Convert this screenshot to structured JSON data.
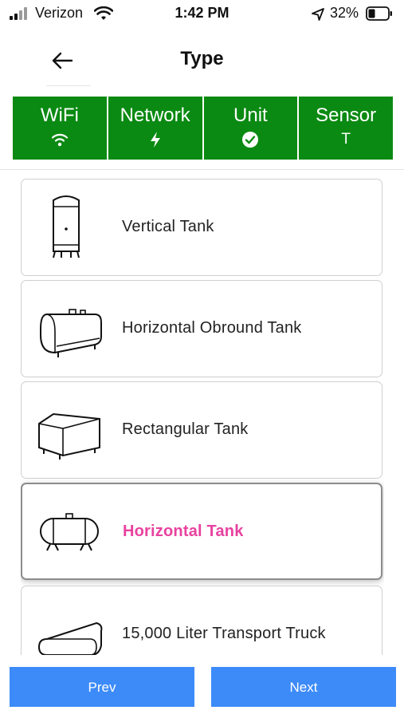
{
  "status": {
    "carrier": "Verizon",
    "time": "1:42 PM",
    "battery": "32%"
  },
  "header": {
    "title": "Type"
  },
  "steps": [
    {
      "label": "WiFi",
      "icon": "wifi-icon"
    },
    {
      "label": "Network",
      "icon": "bolt-icon"
    },
    {
      "label": "Unit",
      "icon": "check-circle-icon"
    },
    {
      "label": "Sensor",
      "icon_text": "T"
    }
  ],
  "tank_types": [
    {
      "label": "Vertical Tank",
      "icon": "vertical-tank-icon"
    },
    {
      "label": "Horizontal Obround Tank",
      "icon": "horizontal-obround-tank-icon"
    },
    {
      "label": "Rectangular Tank",
      "icon": "rectangular-tank-icon"
    },
    {
      "label": "Horizontal Tank",
      "icon": "horizontal-tank-icon",
      "selected": true
    },
    {
      "label": "15,000 Liter Transport Truck",
      "icon": "transport-truck-icon"
    }
  ],
  "buttons": {
    "prev": "Prev",
    "next": "Next"
  },
  "colors": {
    "step_green": "#0a8a12",
    "selected_text": "#e8419f",
    "button_blue": "#3d8bf8"
  }
}
